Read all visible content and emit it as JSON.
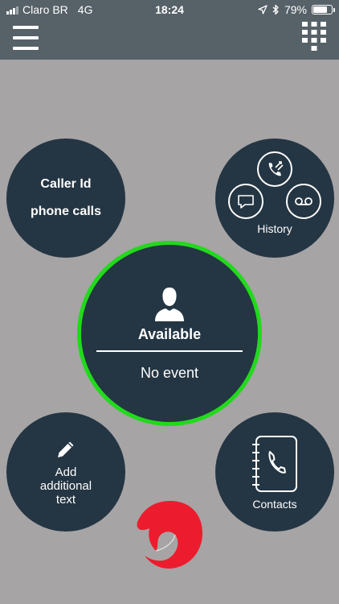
{
  "status_bar": {
    "carrier": "Claro BR",
    "network": "4G",
    "time": "18:24",
    "battery_percent": "79%",
    "battery_level": 0.79
  },
  "header": {
    "menu_icon": "hamburger-menu-icon",
    "dialpad_icon": "dialpad-icon"
  },
  "caller_id": {
    "line1": "Caller Id",
    "line2": "phone calls"
  },
  "history": {
    "label": "History",
    "icons": [
      "call-history-icon",
      "chat-icon",
      "voicemail-icon"
    ]
  },
  "presence": {
    "state": "Available",
    "event": "No event",
    "ring_color": "#22d91c",
    "icon": "user-silhouette-icon"
  },
  "add_text": {
    "label": "Add additional text",
    "icon": "pencil-icon"
  },
  "contacts": {
    "label": "Contacts",
    "icon": "address-book-phone-icon"
  },
  "colors": {
    "background": "#a6a4a5",
    "header": "#566168",
    "circle": "#243543",
    "brand": "#ec1c2e"
  }
}
